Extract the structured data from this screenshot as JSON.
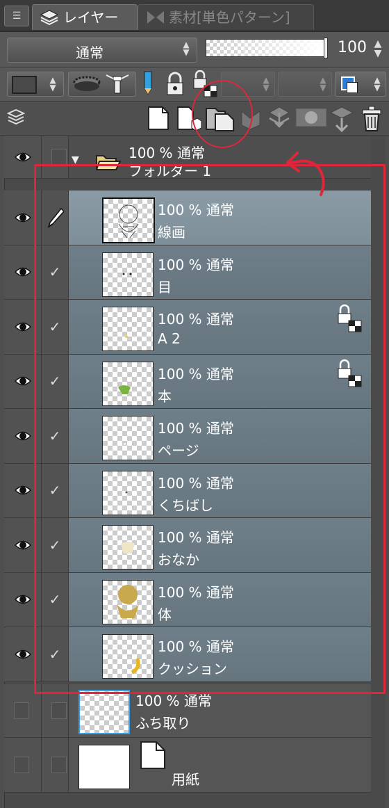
{
  "tabs": {
    "layer_label": "レイヤー",
    "material_label": "素材[単色パターン]"
  },
  "blend": {
    "mode": "通常",
    "opacity": "100"
  },
  "colors": {
    "annotation": "#e0263a",
    "selected_row": "#8a9ba5",
    "layer_row": "#6f7f89",
    "panel_bg": "#4e4e4e",
    "color_icon_blue": "#2e7bd6"
  },
  "folder": {
    "opacity_mode": "100 % 通常",
    "name": "フォルダー 1"
  },
  "layers": [
    {
      "opacity_mode": "100 % 通常",
      "name": "線画",
      "selected": true,
      "edit": "pen",
      "locked": false
    },
    {
      "opacity_mode": "100 % 通常",
      "name": "目",
      "edit": "check",
      "locked": false
    },
    {
      "opacity_mode": "100 % 通常",
      "name": "A 2",
      "edit": "check",
      "locked": true
    },
    {
      "opacity_mode": "100 % 通常",
      "name": "本",
      "edit": "check",
      "locked": true
    },
    {
      "opacity_mode": "100 % 通常",
      "name": "ページ",
      "edit": "check",
      "locked": false
    },
    {
      "opacity_mode": "100 % 通常",
      "name": "くちばし",
      "edit": "check",
      "locked": false
    },
    {
      "opacity_mode": "100 % 通常",
      "name": "おなか",
      "edit": "check",
      "locked": false
    },
    {
      "opacity_mode": "100 % 通常",
      "name": "体",
      "edit": "check",
      "locked": false
    },
    {
      "opacity_mode": "100 % 通常",
      "name": "クッション",
      "edit": "check",
      "locked": false
    }
  ],
  "outline_layer": {
    "opacity_mode": "100 % 通常",
    "name": "ふち取り"
  },
  "paper_layer": {
    "name": "用紙"
  },
  "icons": [
    "layer-stack-icon",
    "new-raster-layer-icon",
    "new-vector-layer-icon",
    "new-folder-icon",
    "transfer-down-icon",
    "merge-down-icon",
    "mask-icon",
    "clip-icon",
    "trash-icon",
    "eye-icon",
    "pen-icon",
    "lock-icon",
    "folder-icon"
  ]
}
